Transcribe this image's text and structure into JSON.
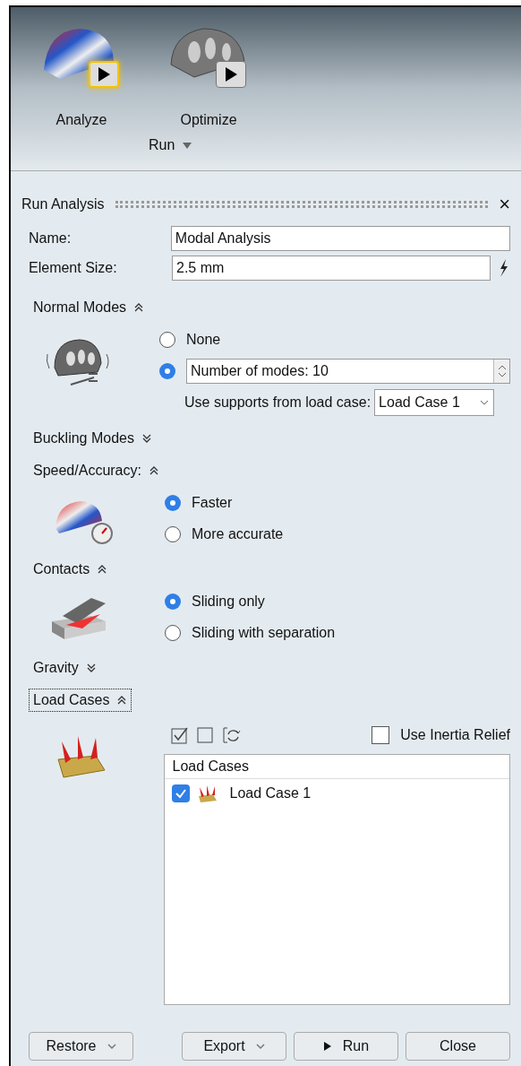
{
  "ribbon": {
    "tools": [
      {
        "label": "Analyze",
        "kind": "analyze",
        "highlighted": true
      },
      {
        "label": "Optimize",
        "kind": "optimize",
        "highlighted": false
      }
    ],
    "group_label": "Run"
  },
  "panel": {
    "title": "Run Analysis",
    "close": "×",
    "fields": [
      {
        "label": "Name:",
        "value": "Modal Analysis",
        "kind": "text"
      },
      {
        "label": "Element Size:",
        "value": "2.5 mm",
        "kind": "lightning"
      }
    ],
    "sections": [
      {
        "title": "Normal Modes",
        "expanded": true,
        "kind": "modes",
        "focused": false,
        "options": [
          {
            "label": "None",
            "selected": false,
            "kind": "plain"
          },
          {
            "label": "Number of modes: 10",
            "selected": true,
            "kind": "spinner"
          }
        ],
        "supports": {
          "label": "Use supports from load case:",
          "value": "Load Case 1"
        }
      },
      {
        "title": "Buckling Modes",
        "expanded": false,
        "focused": false
      },
      {
        "title": "Speed/Accuracy:",
        "expanded": true,
        "kind": "speed",
        "focused": false,
        "options": [
          {
            "label": "Faster",
            "selected": true,
            "kind": "plain"
          },
          {
            "label": "More accurate",
            "selected": false,
            "kind": "plain"
          }
        ]
      },
      {
        "title": "Contacts",
        "expanded": true,
        "kind": "contacts",
        "focused": false,
        "options": [
          {
            "label": "Sliding only",
            "selected": true,
            "kind": "plain"
          },
          {
            "label": "Sliding with separation",
            "selected": false,
            "kind": "plain"
          }
        ]
      },
      {
        "title": "Gravity",
        "expanded": false,
        "focused": false
      },
      {
        "title": "Load Cases",
        "expanded": true,
        "kind": "loads",
        "focused": true,
        "inertia_relief": {
          "label": "Use Inertia Relief",
          "checked": false
        },
        "list": {
          "header": "Load Cases",
          "items": [
            {
              "label": "Load Case 1",
              "checked": true
            }
          ]
        }
      }
    ]
  },
  "footer": [
    {
      "label": "Restore",
      "kind": "dropdown"
    },
    {
      "label": "Export",
      "kind": "dropdown"
    },
    {
      "label": "Run",
      "kind": "play"
    },
    {
      "label": "Close",
      "kind": "plain"
    }
  ]
}
